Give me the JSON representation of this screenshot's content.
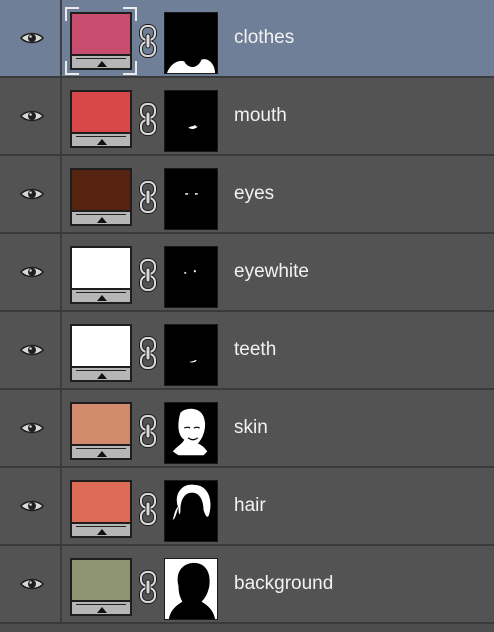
{
  "layers": [
    {
      "name": "clothes",
      "color": "#c84c6e",
      "selected": true,
      "mask": "clothes"
    },
    {
      "name": "mouth",
      "color": "#d94848",
      "selected": false,
      "mask": "mouth"
    },
    {
      "name": "eyes",
      "color": "#55230f",
      "selected": false,
      "mask": "eyes"
    },
    {
      "name": "eyewhite",
      "color": "#ffffff",
      "selected": false,
      "mask": "eyewhite"
    },
    {
      "name": "teeth",
      "color": "#ffffff",
      "selected": false,
      "mask": "teeth"
    },
    {
      "name": "skin",
      "color": "#d18a6b",
      "selected": false,
      "mask": "skin"
    },
    {
      "name": "hair",
      "color": "#dd6a55",
      "selected": false,
      "mask": "hair"
    },
    {
      "name": "background",
      "color": "#8e9570",
      "selected": false,
      "mask": "background"
    }
  ],
  "icons": {
    "visibility": "eye-icon",
    "link": "chain-link-icon",
    "adjustment": "triangle-up-icon"
  }
}
